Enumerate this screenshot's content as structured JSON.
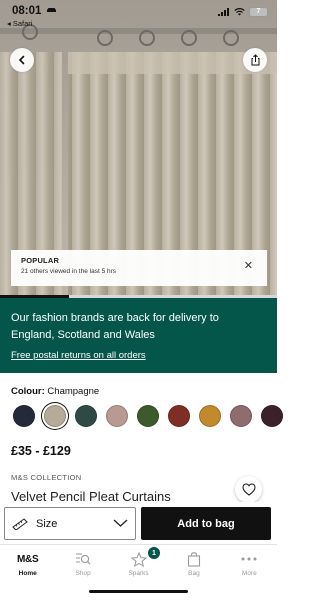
{
  "status_bar": {
    "time": "08:01",
    "back_app": "◂ Safari",
    "battery": "7"
  },
  "hero": {
    "image_alt": "Velvet pencil pleat curtains in champagne",
    "slide_progress_percent": 25,
    "popular": {
      "title": "POPULAR",
      "subtitle": "21 others viewed in the last 5 hrs"
    }
  },
  "promo": {
    "text": "Our fashion brands are back for delivery to England, Scotland and Wales",
    "link": "Free postal returns on all orders",
    "background": "#04554a"
  },
  "product": {
    "colour_label": "Colour:",
    "colour_value": "Champagne",
    "swatches": [
      {
        "name": "navy",
        "color": "#232a3a",
        "selected": false
      },
      {
        "name": "champagne",
        "color": "#b6ab98",
        "selected": true
      },
      {
        "name": "teal",
        "color": "#2f4a44",
        "selected": false
      },
      {
        "name": "blush",
        "color": "#b89a93",
        "selected": false
      },
      {
        "name": "green",
        "color": "#3c5a2c",
        "selected": false
      },
      {
        "name": "rust",
        "color": "#7c2f22",
        "selected": false
      },
      {
        "name": "ochre",
        "color": "#c18a2c",
        "selected": false
      },
      {
        "name": "mauve",
        "color": "#8f6c6d",
        "selected": false
      },
      {
        "name": "plum",
        "color": "#3a2228",
        "selected": false
      }
    ],
    "price": "£35 - £129",
    "brand": "M&S COLLECTION",
    "title": "Velvet Pencil Pleat Curtains"
  },
  "actions": {
    "size_label": "Size",
    "add_to_bag": "Add to bag"
  },
  "tabbar": {
    "items": [
      {
        "label": "Home",
        "logo": "M&S",
        "active": true
      },
      {
        "label": "Shop",
        "icon": "search-list-icon",
        "active": false
      },
      {
        "label": "Sparks",
        "icon": "sparks-star-icon",
        "active": false,
        "badge": "1"
      },
      {
        "label": "Bag",
        "icon": "bag-icon",
        "active": false
      },
      {
        "label": "More",
        "icon": "more-dots-icon",
        "active": false
      }
    ]
  },
  "colors": {
    "accent": "#04554a",
    "button": "#111111"
  }
}
